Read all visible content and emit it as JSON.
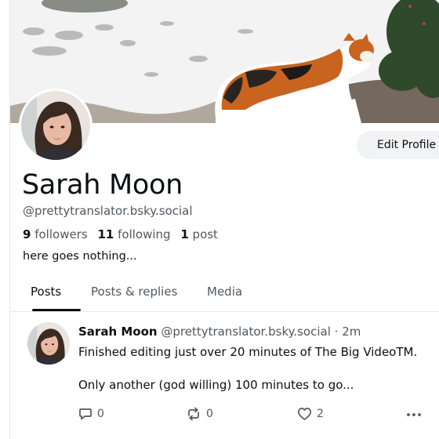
{
  "profile": {
    "display_name": "Sarah Moon",
    "handle": "@prettytranslator.bsky.social",
    "bio": "here goes nothing...",
    "edit_button_label": "Edit Profile",
    "stats": {
      "followers_count": "9",
      "followers_label": "followers",
      "following_count": "11",
      "following_label": "following",
      "posts_count": "1",
      "posts_label": "post"
    }
  },
  "tabs": [
    {
      "label": "Posts",
      "active": true
    },
    {
      "label": "Posts & replies",
      "active": false
    },
    {
      "label": "Media",
      "active": false
    }
  ],
  "post": {
    "author_name": "Sarah Moon",
    "author_handle": "@prettytranslator.bsky.social",
    "separator": "·",
    "time": "2m",
    "text_line1": "Finished editing just over 20 minutes of The Big VideoTM.",
    "text_line2": "Only another (god willing) 100 minutes to go...",
    "reply_count": "0",
    "repost_count": "0",
    "like_count": "2"
  },
  "icons": {
    "reply": "reply-icon",
    "repost": "repost-icon",
    "like": "heart-icon",
    "more": "more-icon"
  },
  "colors": {
    "text_primary": "#0b0f14",
    "text_secondary": "#50585f",
    "button_bg": "#f1f3f5"
  }
}
